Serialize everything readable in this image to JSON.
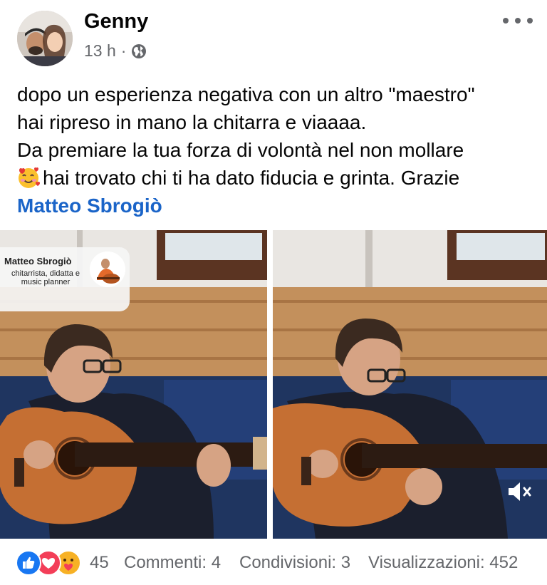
{
  "post": {
    "author": "Genny",
    "time": "13 h",
    "separator": "·",
    "privacy_icon": "globe-icon",
    "text_lines": [
      "dopo un esperienza negativa con un altro \"maestro\"",
      "hai ripreso in mano la chitarra e viaaaa.",
      "Da premiare la tua forza di volontà nel non mollare",
      "hai trovato chi ti ha dato fiducia e grinta. Grazie"
    ],
    "emoji": "smiling-face-with-hearts",
    "mention": "Matteo Sbrogiò"
  },
  "video": {
    "badge_name": "Matteo Sbrogiò",
    "badge_subtitle": "chitarrista, didatta e music planner",
    "mute_icon": "speaker-muted-icon"
  },
  "footer": {
    "reaction_icons": [
      "like-icon",
      "love-icon",
      "care-icon"
    ],
    "reaction_count": "45",
    "comments": "Commenti: 4",
    "shares": "Condivisioni: 3",
    "views": "Visualizzazioni: 452"
  },
  "colors": {
    "mention": "#1a64c8",
    "secondary_text": "#65676b",
    "like": "#1877f2",
    "love": "#f33e58",
    "care": "#f7b125"
  }
}
